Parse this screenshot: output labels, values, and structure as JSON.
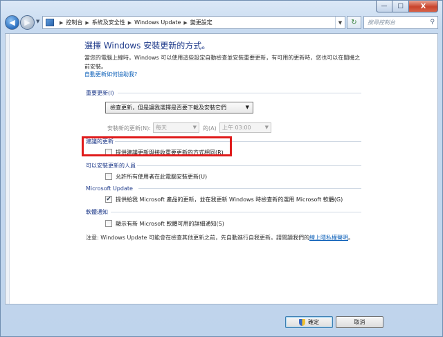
{
  "window": {
    "caption": {
      "minimize": "—",
      "maximize": "□",
      "close": "X"
    }
  },
  "nav": {
    "back_icon": "arrow-left",
    "forward_icon": "arrow-right",
    "breadcrumbs": [
      "控制台",
      "系統及安全性",
      "Windows Update",
      "變更設定"
    ],
    "search_placeholder": "搜尋控制台"
  },
  "page": {
    "title": "選擇 Windows 安裝更新的方式。",
    "description": "當您的電腦上線時，Windows 可以使用這些設定自動檢查並安裝重要更新，有可用的更新時，您也可以在關機之前安裝。",
    "help_link": "自動更新如何協助我?"
  },
  "important_updates": {
    "heading": "重要更新(I)",
    "selected_option": "檢查更新，但是讓我選擇是否要下載及安裝它們",
    "schedule_label": "安裝新的更新(N):",
    "day_value": "每天",
    "at_label": "的(A)",
    "time_value": "上午 03:00"
  },
  "recommended_updates": {
    "heading": "建議的更新",
    "checkbox_label": "提供建議更新與接收重要更新的方式相同(R)",
    "checked": false
  },
  "who_can_install": {
    "heading": "可以安裝更新的人員",
    "checkbox_label": "允許所有使用者在此電腦安裝更新(U)",
    "checked": false
  },
  "microsoft_update": {
    "heading": "Microsoft Update",
    "checkbox_label": "提供給我 Microsoft 產品的更新，並在我更新 Windows 時檢查新的選用 Microsoft 軟體(G)",
    "checked": true
  },
  "software_notifications": {
    "heading": "軟體通知",
    "checkbox_label": "顯示有新 Microsoft 軟體可用的詳細通知(S)",
    "checked": false
  },
  "notice": {
    "text": "注意: Windows Update 可能會在檢查其他更新之前，先自動進行自我更新。請閱讀我們的",
    "link": "線上隱私權聲明",
    "suffix": "。"
  },
  "buttons": {
    "ok": "確定",
    "cancel": "取消"
  },
  "colors": {
    "accent_title": "#1e3a8a",
    "link": "#0b5fb8",
    "highlight": "#e01b1b"
  }
}
